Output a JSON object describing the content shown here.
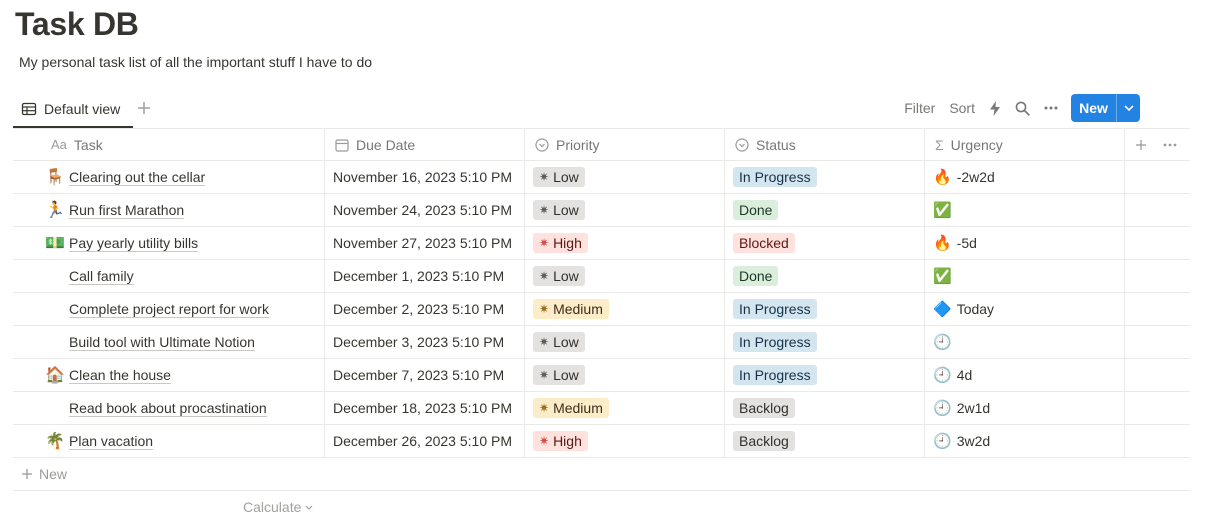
{
  "page": {
    "title": "Task DB",
    "description": "My personal task list of all the important stuff I have to do"
  },
  "view": {
    "tab_label": "Default view",
    "toolbar": {
      "filter": "Filter",
      "sort": "Sort",
      "new_label": "New"
    }
  },
  "table": {
    "headers": {
      "task_icon": "Aa",
      "task": "Task",
      "due": "Due Date",
      "priority": "Priority",
      "status": "Status",
      "urgency_icon": "Σ",
      "urgency": "Urgency"
    },
    "rows": [
      {
        "emoji": "🪑",
        "task": "Clearing out the cellar",
        "due": "November 16, 2023 5:10 PM",
        "priority": "Low",
        "status": "In Progress",
        "urgency_icon": "🔥",
        "urgency": "-2w2d"
      },
      {
        "emoji": "🏃",
        "task": "Run first Marathon",
        "due": "November 24, 2023 5:10 PM",
        "priority": "Low",
        "status": "Done",
        "urgency_icon": "✅",
        "urgency": ""
      },
      {
        "emoji": "💵",
        "task": "Pay yearly utility bills",
        "due": "November 27, 2023 5:10 PM",
        "priority": "High",
        "status": "Blocked",
        "urgency_icon": "🔥",
        "urgency": "-5d"
      },
      {
        "emoji": "",
        "task": "Call family",
        "due": "December 1, 2023 5:10 PM",
        "priority": "Low",
        "status": "Done",
        "urgency_icon": "✅",
        "urgency": ""
      },
      {
        "emoji": "",
        "task": "Complete project report for work",
        "due": "December 2, 2023 5:10 PM",
        "priority": "Medium",
        "status": "In Progress",
        "urgency_icon": "🔷",
        "urgency": "Today"
      },
      {
        "emoji": "",
        "task": "Build tool with Ultimate Notion",
        "due": "December 3, 2023 5:10 PM",
        "priority": "Low",
        "status": "In Progress",
        "urgency_icon": "🕘",
        "urgency": ""
      },
      {
        "emoji": "🏠",
        "task": "Clean the house",
        "due": "December 7, 2023 5:10 PM",
        "priority": "Low",
        "status": "In Progress",
        "urgency_icon": "🕘",
        "urgency": "4d"
      },
      {
        "emoji": "",
        "task": "Read book about procastination",
        "due": "December 18, 2023 5:10 PM",
        "priority": "Medium",
        "status": "Backlog",
        "urgency_icon": "🕘",
        "urgency": "2w1d"
      },
      {
        "emoji": "🌴",
        "task": "Plan vacation",
        "due": "December 26, 2023 5:10 PM",
        "priority": "High",
        "status": "Backlog",
        "urgency_icon": "🕘",
        "urgency": "3w2d"
      }
    ],
    "new_row_label": "New",
    "calculate_label": "Calculate"
  },
  "colors": {
    "accent": "#2383e2",
    "priority": {
      "Low": {
        "bg": "#e3e2e0",
        "fg": "#32302c",
        "mark": "#5a5a5a"
      },
      "Medium": {
        "bg": "#fdecc8",
        "fg": "#402c1b",
        "mark": "#9a6a1a"
      },
      "High": {
        "bg": "#ffe2dd",
        "fg": "#5d1715",
        "mark": "#d44c47"
      }
    },
    "status": {
      "In Progress": {
        "bg": "#d3e5ef",
        "fg": "#183347"
      },
      "Done": {
        "bg": "#dbeddb",
        "fg": "#1c3829"
      },
      "Blocked": {
        "bg": "#ffe2dd",
        "fg": "#5d1715"
      },
      "Backlog": {
        "bg": "#e3e2e0",
        "fg": "#32302c"
      }
    }
  },
  "icons": {
    "view_tab": "table-icon",
    "view_add": "plus-icon",
    "automation": "lightning-icon",
    "search": "search-icon",
    "more": "more-horizontal-icon",
    "dropdown": "chevron-down-icon",
    "due_header": "calendar-icon",
    "select_header": "select-chevron-icon"
  }
}
